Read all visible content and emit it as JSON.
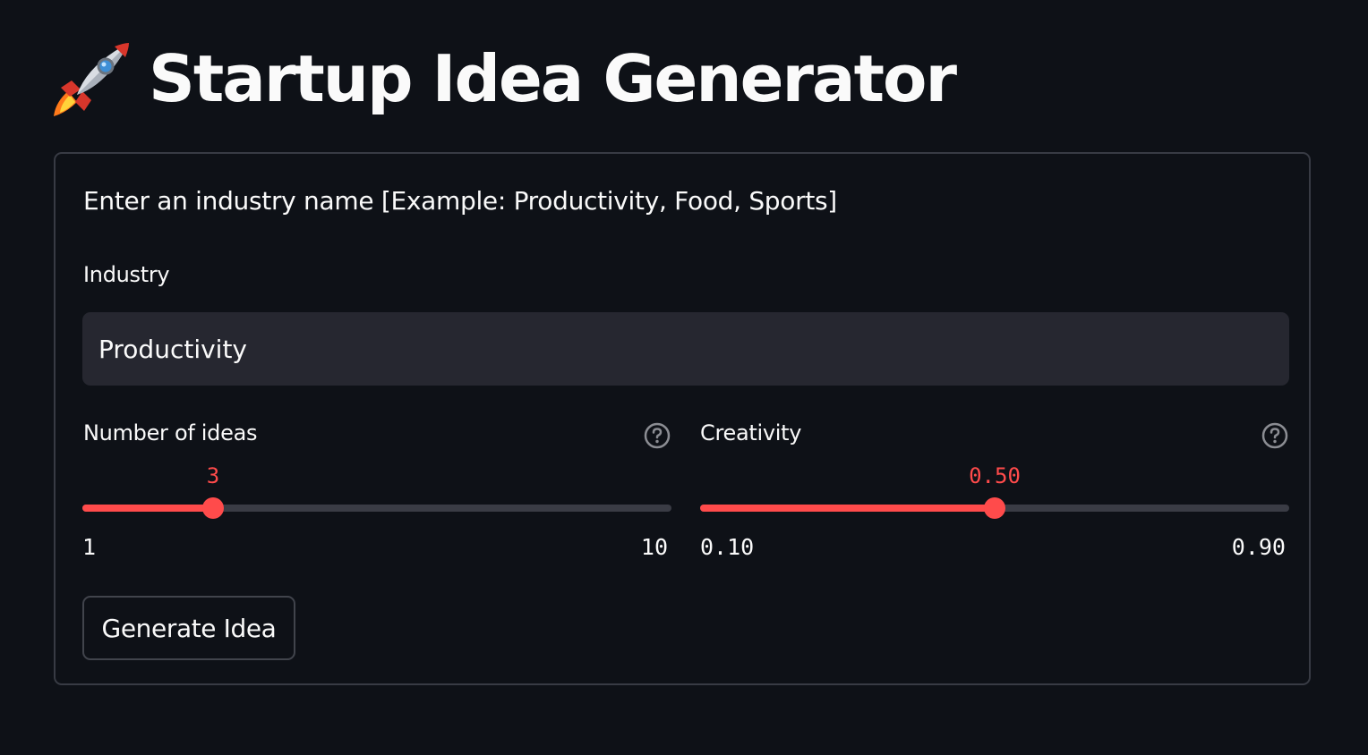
{
  "header": {
    "title": "Startup Idea Generator",
    "icon": "rocket-icon"
  },
  "form": {
    "description": "Enter an industry name [Example: Productivity, Food, Sports]",
    "industry": {
      "label": "Industry",
      "value": "Productivity"
    },
    "num_ideas": {
      "label": "Number of ideas",
      "value": "3",
      "min": "1",
      "max": "10",
      "fraction": 0.2222,
      "help_icon": "help-circle-icon"
    },
    "creativity": {
      "label": "Creativity",
      "value": "0.50",
      "min": "0.10",
      "max": "0.90",
      "fraction": 0.5,
      "help_icon": "help-circle-icon"
    },
    "submit_label": "Generate Idea"
  },
  "colors": {
    "background": "#0e1117",
    "accent": "#ff4b4b",
    "input_bg": "#262730",
    "text": "#fafafa",
    "border": "#383b44"
  }
}
